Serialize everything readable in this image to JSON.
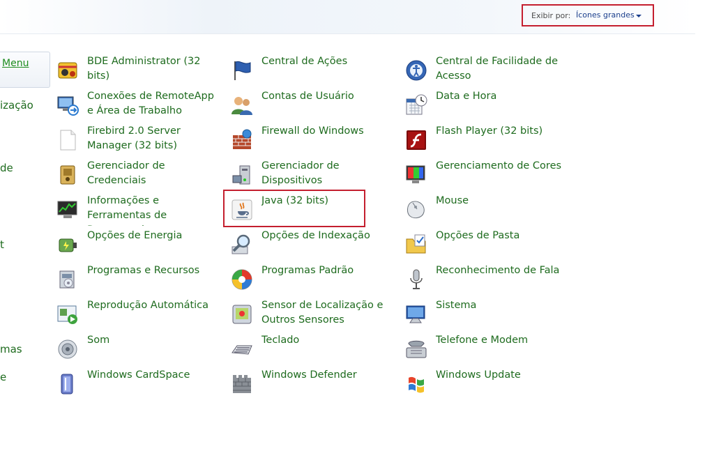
{
  "toolbar": {
    "view_label": "Exibir por:",
    "view_value": "Ícones grandes"
  },
  "sidebar": {
    "link": "Menu",
    "fragments": [
      "ização",
      "de",
      "t",
      "mas",
      "e"
    ]
  },
  "columns": [
    [
      {
        "label": "BDE Administrator (32 bits)",
        "icon": "bde-administrator-icon"
      },
      {
        "label": "Conexões de RemoteApp e Área de Trabalho",
        "icon": "remoteapp-icon"
      },
      {
        "label": "Firebird 2.0 Server Manager (32 bits)",
        "icon": "firebird-document-icon"
      },
      {
        "label": "Gerenciador de Credenciais",
        "icon": "credential-manager-icon"
      },
      {
        "label": "Informações e Ferramentas de Desempenho",
        "icon": "performance-icon"
      },
      {
        "label": "Opções de Energia",
        "icon": "power-options-icon"
      },
      {
        "label": "Programas e Recursos",
        "icon": "programs-features-icon"
      },
      {
        "label": "Reprodução Automática",
        "icon": "autoplay-icon"
      },
      {
        "label": "Som",
        "icon": "speaker-icon"
      },
      {
        "label": "Windows CardSpace",
        "icon": "cardspace-icon"
      }
    ],
    [
      {
        "label": "Central de Ações",
        "icon": "action-center-flag-icon"
      },
      {
        "label": "Contas de Usuário",
        "icon": "user-accounts-icon"
      },
      {
        "label": "Firewall do Windows",
        "icon": "firewall-icon"
      },
      {
        "label": "Gerenciador de Dispositivos",
        "icon": "device-manager-icon"
      },
      {
        "label": "Java (32 bits)",
        "icon": "java-icon"
      },
      {
        "label": "Opções de Indexação",
        "icon": "indexing-options-icon"
      },
      {
        "label": "Programas Padrão",
        "icon": "default-programs-icon"
      },
      {
        "label": "Sensor de Localização e Outros Sensores",
        "icon": "location-sensor-icon"
      },
      {
        "label": "Teclado",
        "icon": "keyboard-icon"
      },
      {
        "label": "Windows Defender",
        "icon": "defender-icon"
      }
    ],
    [
      {
        "label": "Central de Facilidade de Acesso",
        "icon": "ease-of-access-icon"
      },
      {
        "label": "Data e Hora",
        "icon": "date-time-icon"
      },
      {
        "label": "Flash Player (32 bits)",
        "icon": "flash-player-icon"
      },
      {
        "label": "Gerenciamento de Cores",
        "icon": "color-management-icon"
      },
      {
        "label": "Mouse",
        "icon": "mouse-icon"
      },
      {
        "label": "Opções de Pasta",
        "icon": "folder-options-icon"
      },
      {
        "label": "Reconhecimento de Fala",
        "icon": "microphone-icon"
      },
      {
        "label": "Sistema",
        "icon": "system-icon"
      },
      {
        "label": "Telefone e Modem",
        "icon": "phone-modem-icon"
      },
      {
        "label": "Windows Update",
        "icon": "windows-update-icon"
      }
    ]
  ],
  "highlight_color": "#c41e2e",
  "link_color": "#1e6b1e"
}
